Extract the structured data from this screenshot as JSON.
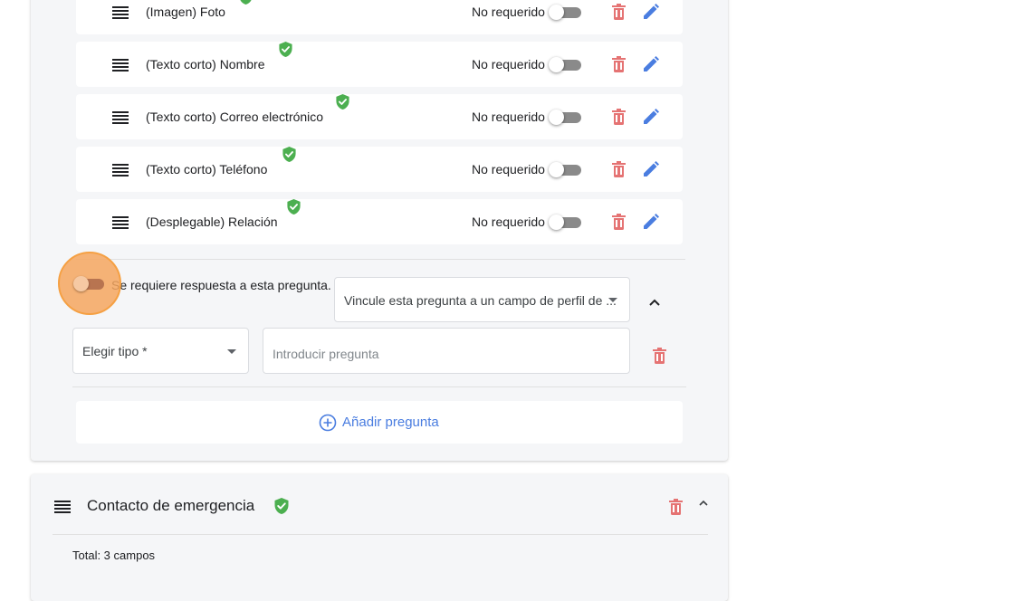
{
  "questions": [
    {
      "label": "(Imagen) Foto",
      "required_label": "No requerido",
      "required": false
    },
    {
      "label": "(Texto corto) Nombre",
      "required_label": "No requerido",
      "required": false
    },
    {
      "label": "(Texto corto) Correo electrónico",
      "required_label": "No requerido",
      "required": false
    },
    {
      "label": "(Texto corto) Teléfono",
      "required_label": "No requerido",
      "required": false
    },
    {
      "label": "(Desplegable) Relación",
      "required_label": "No requerido",
      "required": false
    }
  ],
  "editor": {
    "required_toggle_label": "Se requiere respuesta a esta pregunta.",
    "link_field_placeholder": "Vincule esta pregunta a un campo de perfil de ...",
    "type_select_label": "Elegir tipo *",
    "question_input_placeholder": "Introducir pregunta"
  },
  "add_question_label": "Añadir pregunta",
  "section2": {
    "title": "Contacto de emergencia",
    "total_label": "Total: 3 campos"
  },
  "colors": {
    "accent_blue": "#4285f4",
    "delete_red": "#e57373",
    "verified_green": "#4caf50",
    "highlight_orange": "#f5a043"
  }
}
